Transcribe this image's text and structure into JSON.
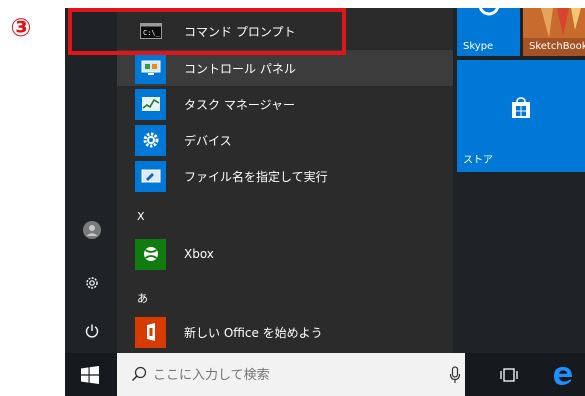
{
  "annotation": {
    "step_marker": "③"
  },
  "app_list": {
    "items": [
      {
        "label": "コマンド プロンプト",
        "icon": "command-prompt-icon"
      },
      {
        "label": "コントロール パネル",
        "icon": "control-panel-icon"
      },
      {
        "label": "タスク マネージャー",
        "icon": "task-manager-icon"
      },
      {
        "label": "デバイス",
        "icon": "gear-icon"
      },
      {
        "label": "ファイル名を指定して実行",
        "icon": "run-icon"
      }
    ],
    "section_x": "X",
    "xbox": {
      "label": "Xbox",
      "icon": "xbox-icon"
    },
    "section_a": "あ",
    "office": {
      "label": "新しい Office を始めよう",
      "icon": "office-icon"
    }
  },
  "left_rail": {
    "icons": [
      "user-avatar-icon",
      "settings-icon",
      "power-icon"
    ]
  },
  "tiles": {
    "skype": "Skype",
    "sketchbook": "SketchBook",
    "store": "ストア"
  },
  "taskbar": {
    "search_placeholder": "ここに入力して検索",
    "icons": [
      "windows-start-icon",
      "search-icon",
      "microphone-icon",
      "task-view-icon",
      "edge-icon"
    ]
  },
  "colors": {
    "accent": "#0078d7",
    "highlight": "#e0151c",
    "menu_bg": "#2b2b2b",
    "xbox": "#107c10",
    "office": "#d83b01"
  }
}
